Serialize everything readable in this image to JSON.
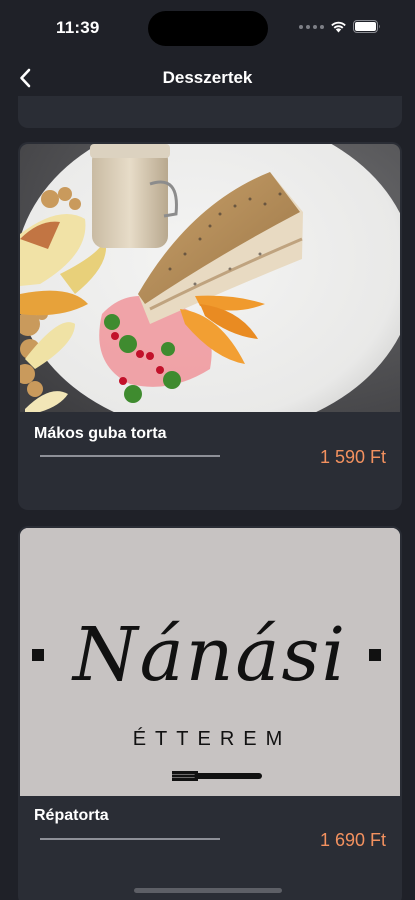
{
  "status_bar": {
    "time": "11:39"
  },
  "nav": {
    "title": "Desszertek",
    "back_icon": "chevron-left-icon"
  },
  "products": [
    {
      "name": "Mákos guba torta",
      "price": "1 590 Ft",
      "image": "dessert-plate-photo"
    },
    {
      "name": "Répatorta",
      "price": "1 690 Ft",
      "image": "restaurant-logo-placeholder",
      "logo": {
        "name": "Nánási",
        "subtitle": "ÉTTEREM"
      }
    }
  ],
  "colors": {
    "background": "#1f2128",
    "card": "#2a2d35",
    "price": "#f3915f",
    "logo_bg": "#c7c3c2"
  }
}
